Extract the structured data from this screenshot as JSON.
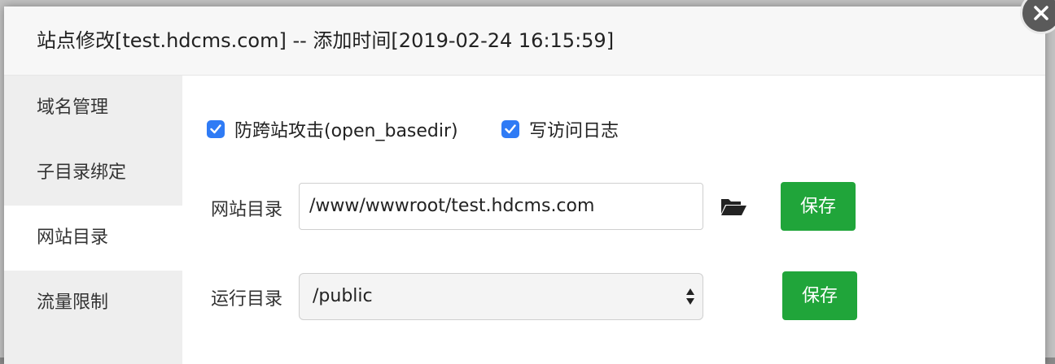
{
  "dialog": {
    "title": "站点修改[test.hdcms.com] -- 添加时间[2019-02-24 16:15:59]"
  },
  "sidebar": {
    "items": [
      {
        "label": "域名管理",
        "active": false
      },
      {
        "label": "子目录绑定",
        "active": false
      },
      {
        "label": "网站目录",
        "active": true
      },
      {
        "label": "流量限制",
        "active": false
      }
    ]
  },
  "options": {
    "anti_xss": {
      "label": "防跨站攻击(open_basedir)",
      "checked": true
    },
    "access_log": {
      "label": "写访问日志",
      "checked": true
    }
  },
  "site_dir": {
    "label": "网站目录",
    "value": "/www/wwwroot/test.hdcms.com",
    "save_label": "保存"
  },
  "run_dir": {
    "label": "运行目录",
    "selected": "/public",
    "save_label": "保存"
  },
  "colors": {
    "primary_green": "#20a53a",
    "checkbox_blue": "#2f7bf5"
  }
}
